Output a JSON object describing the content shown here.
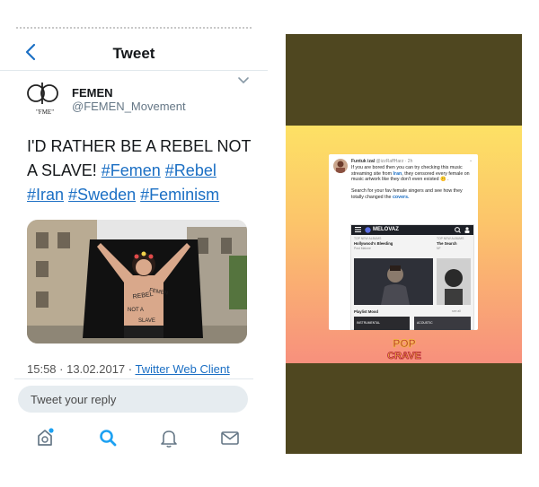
{
  "left": {
    "nav": {
      "title": "Tweet"
    },
    "user": {
      "name": "FEMEN",
      "handle": "@FEMEN_Movement",
      "logo_text": "\"FME\""
    },
    "tweet": {
      "text_prefix": "I'D RATHER BE A REBEL NOT A SLAVE!",
      "hashtags": [
        "#Femen",
        "#Rebel",
        "#Iran",
        "#Sweden",
        "#Feminism"
      ]
    },
    "meta": {
      "time": "15:58 · 13.02.2017 · ",
      "client": "Twitter Web Client"
    },
    "reply": {
      "placeholder": "Tweet your reply"
    },
    "photo_text": [
      "REBEL",
      "FEMEN",
      "NOT A",
      "SLAVE"
    ],
    "tabs": [
      "home-icon",
      "search-icon",
      "bell-icon",
      "mail-icon"
    ],
    "colors": {
      "accent": "#1b6fc4",
      "search_active": "#1da1f2"
    }
  },
  "right": {
    "card": {
      "name": "Funtuk izal",
      "handle": "@izzRaffHarz · 2h",
      "body_1": "If you are bored then you can try checking this music streaming site from",
      "body_iran": "Iran",
      "body_2": ", they censored every female on music artwork like they don't even existed 🤫 .",
      "body_3": "Search for your fav female singers and see how they totally changed the",
      "body_covers": "covers.",
      "app_name": "MELOVAZ",
      "album_head_1": "TOP NEW ALBUMS",
      "album_1": "Hollywood's Bleeding",
      "artist_1": "Post Malone",
      "album_head_2": "TOP NEW ALBUMS",
      "album_2": "The Search",
      "artist_2": "NF",
      "playlist": "Playlist Mood",
      "see_all": "see all",
      "tile_1": "INSTRUMENTAL",
      "tile_2": "ACOUSTIC"
    },
    "brand": {
      "line1": "POP",
      "line2": "CRAVE"
    },
    "colors": {
      "background": "#4f4720",
      "gradient_top": "#fde165",
      "gradient_bottom": "#f7907d"
    }
  }
}
